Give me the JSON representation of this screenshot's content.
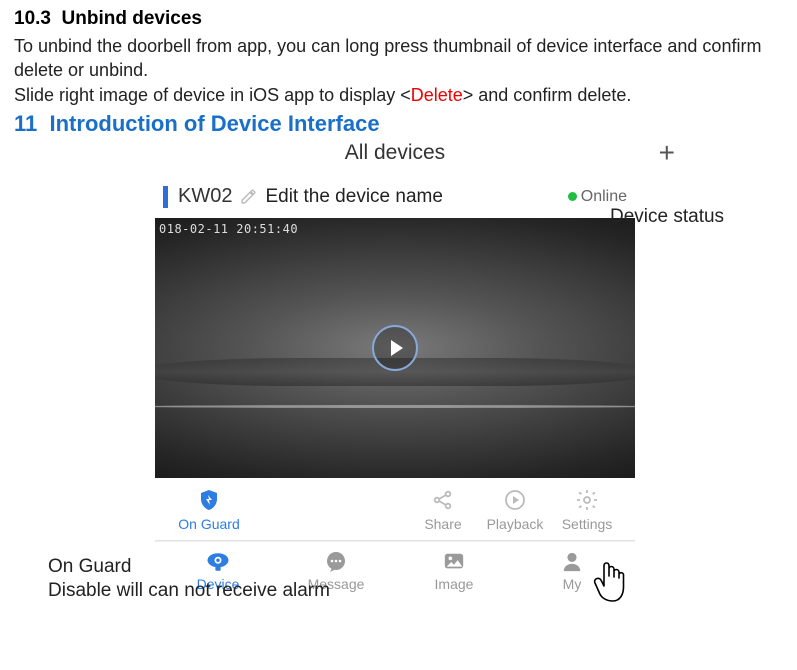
{
  "section_10_3": {
    "number": "10.3",
    "title": "Unbind devices",
    "body_line1": "To unbind the doorbell from app,  you can long press thumbnail of device interface and  confirm delete or unbind.",
    "body_line2_pre": "Slide right image of device in iOS app to display <",
    "body_line2_delete": "Delete",
    "body_line2_post": "> and confirm delete."
  },
  "section_11": {
    "number": "11",
    "title": "Introduction of Device Interface"
  },
  "app": {
    "header_title": "All devices",
    "device_name": "KW02",
    "online_label": "Online",
    "timestamp": "018-02-11  20:51:40",
    "actions": {
      "on_guard": "On Guard",
      "share": "Share",
      "playback": "Playback",
      "settings": "Settings"
    },
    "nav": {
      "device": "Device",
      "message": "Message",
      "image": "Image",
      "my": "My"
    }
  },
  "annotations": {
    "edit_name": "Edit the device name",
    "device_status": "Device status",
    "on_guard_title": "On Guard",
    "on_guard_desc": "Disable will can not receive alarm"
  }
}
